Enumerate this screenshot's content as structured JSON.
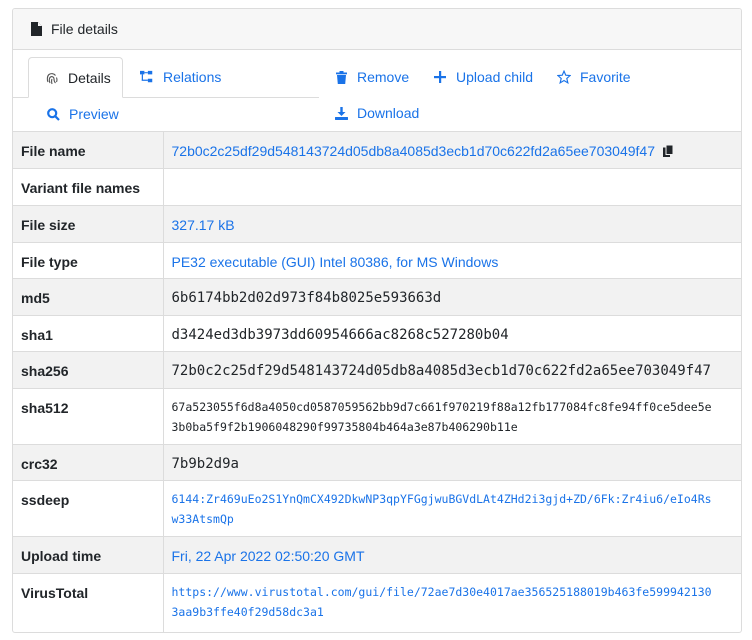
{
  "header": {
    "title": "File details",
    "icon": "file-icon"
  },
  "nav": {
    "details": "Details",
    "relations": "Relations",
    "remove": "Remove",
    "upload_child": "Upload child",
    "favorite": "Favorite",
    "preview": "Preview",
    "download": "Download"
  },
  "rows": {
    "file_name": {
      "label": "File name",
      "value": "72b0c2c25df29d548143724d05db8a4085d3ecb1d70c622fd2a65ee703049f47"
    },
    "variant": {
      "label": "Variant file names",
      "value": ""
    },
    "file_size": {
      "label": "File size",
      "value": "327.17 kB"
    },
    "file_type": {
      "label": "File type",
      "value": "PE32 executable (GUI) Intel 80386, for MS Windows"
    },
    "md5": {
      "label": "md5",
      "value": "6b6174bb2d02d973f84b8025e593663d"
    },
    "sha1": {
      "label": "sha1",
      "value": "d3424ed3db3973dd60954666ac8268c527280b04"
    },
    "sha256": {
      "label": "sha256",
      "value": "72b0c2c25df29d548143724d05db8a4085d3ecb1d70c622fd2a65ee703049f47"
    },
    "sha512": {
      "label": "sha512",
      "line1": "67a523055f6d8a4050cd0587059562bb9d7c661f970219f88a12fb177084fc8fe94ff0ce5dee5e",
      "line2": "3b0ba5f9f2b1906048290f99735804b464a3e87b406290b11e"
    },
    "crc32": {
      "label": "crc32",
      "value": "7b9b2d9a"
    },
    "ssdeep": {
      "label": "ssdeep",
      "line1": "6144:Zr469uEo2S1YnQmCX492DkwNP3qpYFGgjwuBGVdLAt4ZHd2i3gjd+ZD/6Fk:Zr4iu6/eIo4Rs",
      "line2": "w33AtsmQp"
    },
    "upload_time": {
      "label": "Upload time",
      "value": "Fri, 22 Apr 2022 02:50:20 GMT"
    },
    "virustotal": {
      "label": "VirusTotal",
      "line1": "https://www.virustotal.com/gui/file/72ae7d30e4017ae356525188019b463fe599942130",
      "line2": "3aa9b3ffe40f29d58dc3a1"
    }
  },
  "colors": {
    "link": "#1a73e8",
    "row_alt": "#f2f2f2",
    "border": "#dcdcdc"
  }
}
